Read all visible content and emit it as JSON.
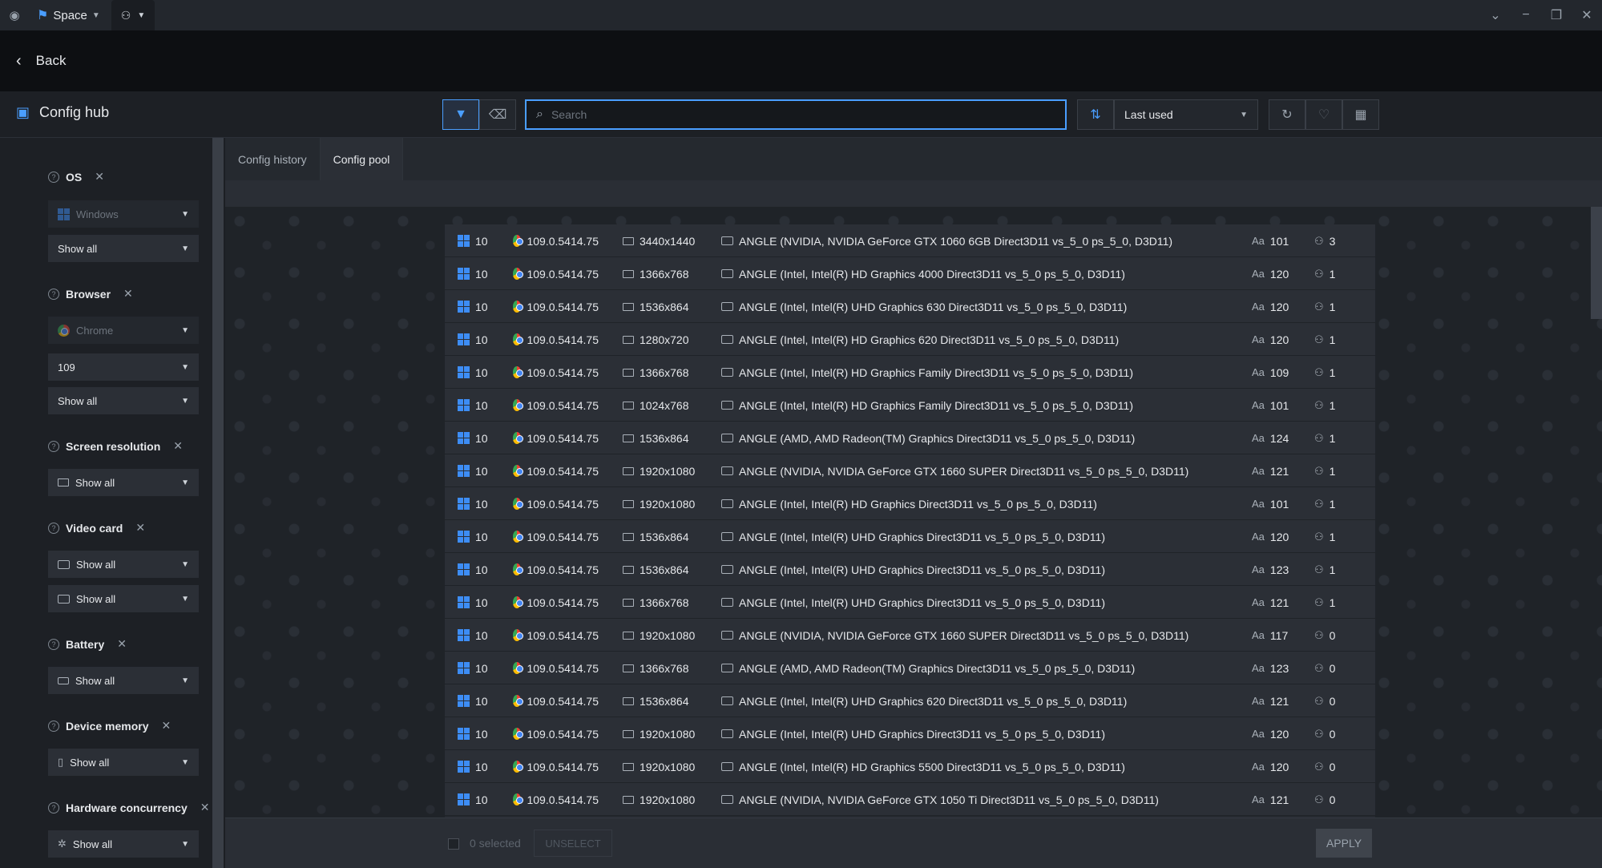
{
  "titlebar": {
    "space_label": "Space",
    "tab_icon": "users-icon"
  },
  "backbar": {
    "back_label": "Back"
  },
  "header": {
    "title": "Config hub",
    "search_placeholder": "Search",
    "sort_value": "Last used"
  },
  "tabs": [
    {
      "label": "Config history",
      "active": false
    },
    {
      "label": "Config pool",
      "active": true
    }
  ],
  "sidebar": {
    "os": {
      "title": "OS",
      "os_value": "Windows",
      "version_value": "Show all"
    },
    "browser": {
      "title": "Browser",
      "browser_value": "Chrome",
      "version_value": "109",
      "build_value": "Show all"
    },
    "screen": {
      "title": "Screen resolution",
      "value": "Show all"
    },
    "video": {
      "title": "Video card",
      "value1": "Show all",
      "value2": "Show all"
    },
    "battery": {
      "title": "Battery",
      "value": "Show all"
    },
    "memory": {
      "title": "Device memory",
      "value": "Show all"
    },
    "hardware": {
      "title": "Hardware concurrency",
      "value": "Show all"
    }
  },
  "rows": [
    {
      "os": "10",
      "browser": "109.0.5414.75",
      "res": "3440x1440",
      "gpu": "ANGLE (NVIDIA, NVIDIA GeForce GTX 1060 6GB Direct3D11 vs_5_0 ps_5_0, D3D11)",
      "fonts": "101",
      "used": "3"
    },
    {
      "os": "10",
      "browser": "109.0.5414.75",
      "res": "1366x768",
      "gpu": "ANGLE (Intel, Intel(R) HD Graphics 4000 Direct3D11 vs_5_0 ps_5_0, D3D11)",
      "fonts": "120",
      "used": "1"
    },
    {
      "os": "10",
      "browser": "109.0.5414.75",
      "res": "1536x864",
      "gpu": "ANGLE (Intel, Intel(R) UHD Graphics 630 Direct3D11 vs_5_0 ps_5_0, D3D11)",
      "fonts": "120",
      "used": "1"
    },
    {
      "os": "10",
      "browser": "109.0.5414.75",
      "res": "1280x720",
      "gpu": "ANGLE (Intel, Intel(R) HD Graphics 620 Direct3D11 vs_5_0 ps_5_0, D3D11)",
      "fonts": "120",
      "used": "1"
    },
    {
      "os": "10",
      "browser": "109.0.5414.75",
      "res": "1366x768",
      "gpu": "ANGLE (Intel, Intel(R) HD Graphics Family Direct3D11 vs_5_0 ps_5_0, D3D11)",
      "fonts": "109",
      "used": "1"
    },
    {
      "os": "10",
      "browser": "109.0.5414.75",
      "res": "1024x768",
      "gpu": "ANGLE (Intel, Intel(R) HD Graphics Family Direct3D11 vs_5_0 ps_5_0, D3D11)",
      "fonts": "101",
      "used": "1"
    },
    {
      "os": "10",
      "browser": "109.0.5414.75",
      "res": "1536x864",
      "gpu": "ANGLE (AMD, AMD Radeon(TM) Graphics Direct3D11 vs_5_0 ps_5_0, D3D11)",
      "fonts": "124",
      "used": "1"
    },
    {
      "os": "10",
      "browser": "109.0.5414.75",
      "res": "1920x1080",
      "gpu": "ANGLE (NVIDIA, NVIDIA GeForce GTX 1660 SUPER Direct3D11 vs_5_0 ps_5_0, D3D11)",
      "fonts": "121",
      "used": "1"
    },
    {
      "os": "10",
      "browser": "109.0.5414.75",
      "res": "1920x1080",
      "gpu": "ANGLE (Intel, Intel(R) HD Graphics Direct3D11 vs_5_0 ps_5_0, D3D11)",
      "fonts": "101",
      "used": "1"
    },
    {
      "os": "10",
      "browser": "109.0.5414.75",
      "res": "1536x864",
      "gpu": "ANGLE (Intel, Intel(R) UHD Graphics Direct3D11 vs_5_0 ps_5_0, D3D11)",
      "fonts": "120",
      "used": "1"
    },
    {
      "os": "10",
      "browser": "109.0.5414.75",
      "res": "1536x864",
      "gpu": "ANGLE (Intel, Intel(R) UHD Graphics Direct3D11 vs_5_0 ps_5_0, D3D11)",
      "fonts": "123",
      "used": "1"
    },
    {
      "os": "10",
      "browser": "109.0.5414.75",
      "res": "1366x768",
      "gpu": "ANGLE (Intel, Intel(R) UHD Graphics Direct3D11 vs_5_0 ps_5_0, D3D11)",
      "fonts": "121",
      "used": "1"
    },
    {
      "os": "10",
      "browser": "109.0.5414.75",
      "res": "1920x1080",
      "gpu": "ANGLE (NVIDIA, NVIDIA GeForce GTX 1660 SUPER Direct3D11 vs_5_0 ps_5_0, D3D11)",
      "fonts": "117",
      "used": "0"
    },
    {
      "os": "10",
      "browser": "109.0.5414.75",
      "res": "1366x768",
      "gpu": "ANGLE (AMD, AMD Radeon(TM) Graphics Direct3D11 vs_5_0 ps_5_0, D3D11)",
      "fonts": "123",
      "used": "0"
    },
    {
      "os": "10",
      "browser": "109.0.5414.75",
      "res": "1536x864",
      "gpu": "ANGLE (Intel, Intel(R) UHD Graphics 620 Direct3D11 vs_5_0 ps_5_0, D3D11)",
      "fonts": "121",
      "used": "0"
    },
    {
      "os": "10",
      "browser": "109.0.5414.75",
      "res": "1920x1080",
      "gpu": "ANGLE (Intel, Intel(R) UHD Graphics Direct3D11 vs_5_0 ps_5_0, D3D11)",
      "fonts": "120",
      "used": "0"
    },
    {
      "os": "10",
      "browser": "109.0.5414.75",
      "res": "1920x1080",
      "gpu": "ANGLE (Intel, Intel(R) HD Graphics 5500 Direct3D11 vs_5_0 ps_5_0, D3D11)",
      "fonts": "120",
      "used": "0"
    },
    {
      "os": "10",
      "browser": "109.0.5414.75",
      "res": "1920x1080",
      "gpu": "ANGLE (NVIDIA, NVIDIA GeForce GTX 1050 Ti Direct3D11 vs_5_0 ps_5_0, D3D11)",
      "fonts": "121",
      "used": "0"
    }
  ],
  "footer": {
    "selected_label": "0 selected",
    "unselect_label": "UNSELECT",
    "apply_label": "APPLY"
  },
  "colors": {
    "accent": "#4a9eff",
    "windows": "#3d8df5"
  }
}
